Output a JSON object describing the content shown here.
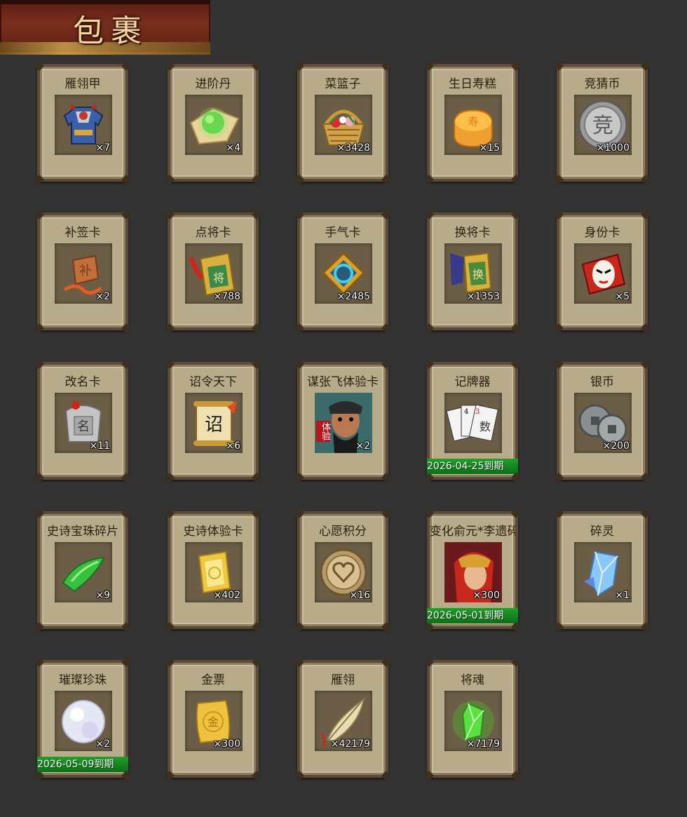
{
  "header": {
    "title": "包裹"
  },
  "items": [
    {
      "name": "雁翎甲",
      "count": "×7",
      "icon": "armor-icon"
    },
    {
      "name": "进阶丹",
      "count": "×4",
      "icon": "green-pill-icon"
    },
    {
      "name": "菜篮子",
      "count": "×3428",
      "icon": "basket-icon"
    },
    {
      "name": "生日寿糕",
      "count": "×15",
      "icon": "cake-icon"
    },
    {
      "name": "竞猜币",
      "count": "×1000",
      "icon": "silver-coin-icon"
    },
    {
      "name": "补签卡",
      "count": "×2",
      "icon": "sign-card-icon"
    },
    {
      "name": "点将卡",
      "count": "×788",
      "icon": "general-card-icon"
    },
    {
      "name": "手气卡",
      "count": "×2485",
      "icon": "luck-card-icon"
    },
    {
      "name": "换将卡",
      "count": "×1353",
      "icon": "swap-card-icon"
    },
    {
      "name": "身份卡",
      "count": "×5",
      "icon": "mask-card-icon"
    },
    {
      "name": "改名卡",
      "count": "×11",
      "icon": "rename-card-icon"
    },
    {
      "name": "诏令天下",
      "count": "×6",
      "icon": "scroll-icon"
    },
    {
      "name": "谋张飞体验卡",
      "count": "×2",
      "icon": "hero-portrait-icon",
      "badge": "体验"
    },
    {
      "name": "记牌器",
      "count": "",
      "icon": "playing-cards-icon",
      "expiry": "2026-04-25到期"
    },
    {
      "name": "银币",
      "count": "×200",
      "icon": "coins-icon"
    },
    {
      "name": "史诗宝珠碎片",
      "count": "×9",
      "icon": "green-shard-icon"
    },
    {
      "name": "史诗体验卡",
      "count": "×402",
      "icon": "gold-card-icon"
    },
    {
      "name": "心愿积分",
      "count": "×16",
      "icon": "heart-coin-icon"
    },
    {
      "name": "变化俞元*李遗碎片",
      "count": "×300",
      "icon": "hero-fragment-icon",
      "expiry": "2026-05-01到期"
    },
    {
      "name": "碎灵",
      "count": "×1",
      "icon": "crystal-icon"
    },
    {
      "name": "璀璨珍珠",
      "count": "×2",
      "icon": "pearl-icon",
      "expiry": "2026-05-09到期"
    },
    {
      "name": "金票",
      "count": "×300",
      "icon": "gold-ticket-icon"
    },
    {
      "name": "雁翎",
      "count": "×42179",
      "icon": "feather-icon"
    },
    {
      "name": "将魂",
      "count": "×7179",
      "icon": "soul-gem-icon"
    }
  ],
  "colors": {
    "background": "#333333",
    "card": "#b8ab8a",
    "expiry_bar": "#1a8f24",
    "banner": "#7a2e1c"
  }
}
